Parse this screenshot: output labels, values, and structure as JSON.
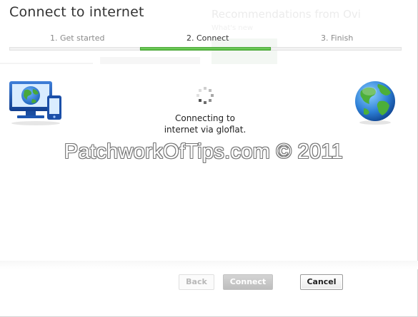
{
  "background": {
    "ghost_heading": "Recommendations from Ovi",
    "ghost_subheading": "What's new"
  },
  "dialog": {
    "title": "Connect to internet",
    "steps": [
      {
        "label": "1. Get started",
        "state": "done"
      },
      {
        "label": "2. Connect",
        "state": "active"
      },
      {
        "label": "3. Finish",
        "state": "pending"
      }
    ],
    "status_line1": "Connecting to",
    "status_line2": "internet via gloflat.",
    "icons": {
      "left": "computer-phone-icon",
      "right": "globe-icon",
      "center": "loading-spinner-icon"
    },
    "buttons": {
      "back": "Back",
      "connect": "Connect",
      "cancel": "Cancel"
    }
  },
  "watermark": "PatchworkOfTips.com © 2011",
  "colors": {
    "progress_active": "#4fb83a",
    "title_text": "#333333",
    "monitor_blue": "#1f57b8"
  }
}
